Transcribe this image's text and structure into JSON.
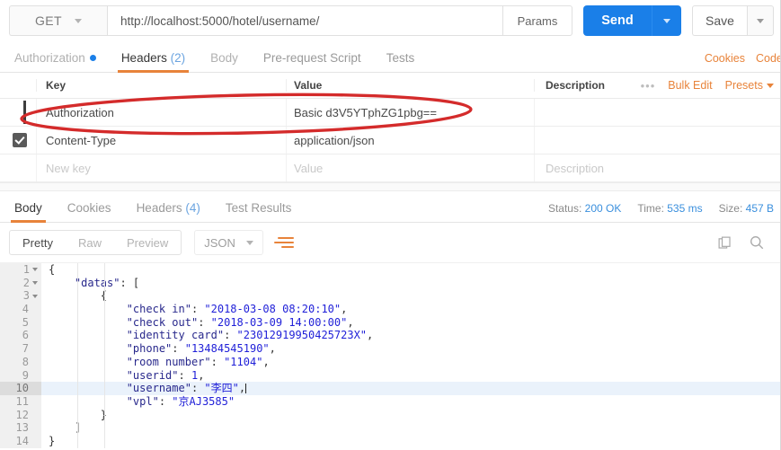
{
  "request": {
    "method": "GET",
    "url": "http://localhost:5000/hotel/username/",
    "params_label": "Params",
    "send_label": "Send",
    "save_label": "Save",
    "tabs": [
      {
        "label": "Authorization",
        "state": "has-dot"
      },
      {
        "label": "Headers",
        "count": "(2)",
        "state": "active"
      },
      {
        "label": "Body",
        "state": "disabled"
      },
      {
        "label": "Pre-request Script",
        "state": "normal"
      },
      {
        "label": "Tests",
        "state": "normal"
      }
    ],
    "links": {
      "cookies": "Cookies",
      "code": "Code"
    }
  },
  "headers_table": {
    "columns": {
      "key": "Key",
      "value": "Value",
      "description": "Description"
    },
    "tools": {
      "dots": "•••",
      "bulk_edit": "Bulk Edit",
      "presets": "Presets"
    },
    "rows": [
      {
        "checked": false,
        "handle": true,
        "key": "Authorization",
        "value": "Basic d3V5YTphZG1pbg==",
        "description": ""
      },
      {
        "checked": true,
        "handle": false,
        "key": "Content-Type",
        "value": "application/json",
        "description": ""
      }
    ],
    "new_row": {
      "key_placeholder": "New key",
      "value_placeholder": "Value",
      "description_placeholder": "Description"
    }
  },
  "annotation": {
    "shape": "ellipse",
    "color": "#d42b2b",
    "target": "Authorization header row"
  },
  "response": {
    "tabs": [
      {
        "label": "Body",
        "state": "active"
      },
      {
        "label": "Cookies",
        "state": "normal"
      },
      {
        "label": "Headers",
        "count": "(4)",
        "state": "normal"
      },
      {
        "label": "Test Results",
        "state": "normal"
      }
    ],
    "status": {
      "status_label": "Status:",
      "status_value": "200 OK",
      "time_label": "Time:",
      "time_value": "535 ms",
      "size_label": "Size:",
      "size_value": "457 B"
    },
    "view_modes": [
      {
        "label": "Pretty",
        "state": "active"
      },
      {
        "label": "Raw",
        "state": "normal"
      },
      {
        "label": "Preview",
        "state": "normal"
      }
    ],
    "format": "JSON",
    "icons": {
      "wrap": "word-wrap-icon",
      "copy": "copy-icon",
      "search": "search-icon"
    }
  },
  "body_code": {
    "language": "json",
    "highlighted_line": 10,
    "cursor_line": 10,
    "lines": [
      {
        "n": "1",
        "fold": true,
        "tokens": [
          {
            "t": "{",
            "c": "p"
          }
        ],
        "indent": 0
      },
      {
        "n": "2",
        "fold": true,
        "tokens": [
          {
            "t": "\"datas\"",
            "c": "k"
          },
          {
            "t": ": [",
            "c": "p"
          }
        ],
        "indent": 1
      },
      {
        "n": "3",
        "fold": true,
        "tokens": [
          {
            "t": "{",
            "c": "p"
          }
        ],
        "indent": 2
      },
      {
        "n": "4",
        "fold": false,
        "tokens": [
          {
            "t": "\"check in\"",
            "c": "k"
          },
          {
            "t": ": ",
            "c": "p"
          },
          {
            "t": "\"2018-03-08 08:20:10\"",
            "c": "s"
          },
          {
            "t": ",",
            "c": "p"
          }
        ],
        "indent": 3
      },
      {
        "n": "5",
        "fold": false,
        "tokens": [
          {
            "t": "\"check out\"",
            "c": "k"
          },
          {
            "t": ": ",
            "c": "p"
          },
          {
            "t": "\"2018-03-09 14:00:00\"",
            "c": "s"
          },
          {
            "t": ",",
            "c": "p"
          }
        ],
        "indent": 3
      },
      {
        "n": "6",
        "fold": false,
        "tokens": [
          {
            "t": "\"identity card\"",
            "c": "k"
          },
          {
            "t": ": ",
            "c": "p"
          },
          {
            "t": "\"23012919950425723X\"",
            "c": "s"
          },
          {
            "t": ",",
            "c": "p"
          }
        ],
        "indent": 3
      },
      {
        "n": "7",
        "fold": false,
        "tokens": [
          {
            "t": "\"phone\"",
            "c": "k"
          },
          {
            "t": ": ",
            "c": "p"
          },
          {
            "t": "\"13484545190\"",
            "c": "s"
          },
          {
            "t": ",",
            "c": "p"
          }
        ],
        "indent": 3
      },
      {
        "n": "8",
        "fold": false,
        "tokens": [
          {
            "t": "\"room number\"",
            "c": "k"
          },
          {
            "t": ": ",
            "c": "p"
          },
          {
            "t": "\"1104\"",
            "c": "s"
          },
          {
            "t": ",",
            "c": "p"
          }
        ],
        "indent": 3
      },
      {
        "n": "9",
        "fold": false,
        "tokens": [
          {
            "t": "\"userid\"",
            "c": "k"
          },
          {
            "t": ": ",
            "c": "p"
          },
          {
            "t": "1",
            "c": "n"
          },
          {
            "t": ",",
            "c": "p"
          }
        ],
        "indent": 3
      },
      {
        "n": "10",
        "fold": false,
        "tokens": [
          {
            "t": "\"username\"",
            "c": "k"
          },
          {
            "t": ": ",
            "c": "p"
          },
          {
            "t": "\"李四\"",
            "c": "s"
          },
          {
            "t": ",",
            "c": "p"
          }
        ],
        "indent": 3,
        "cursor": true
      },
      {
        "n": "11",
        "fold": false,
        "tokens": [
          {
            "t": "\"vpl\"",
            "c": "k"
          },
          {
            "t": ": ",
            "c": "p"
          },
          {
            "t": "\"京AJ3585\"",
            "c": "s"
          }
        ],
        "indent": 3
      },
      {
        "n": "12",
        "fold": false,
        "tokens": [
          {
            "t": "}",
            "c": "p"
          }
        ],
        "indent": 2
      },
      {
        "n": "13",
        "fold": false,
        "tokens": [
          {
            "t": "]",
            "c": "p"
          }
        ],
        "indent": 1
      },
      {
        "n": "14",
        "fold": false,
        "tokens": [
          {
            "t": "}",
            "c": "p"
          }
        ],
        "indent": 0
      }
    ]
  },
  "colors": {
    "accent_orange": "#e8833a",
    "send_blue": "#1a7fe8",
    "link_blue": "#3a8fdd",
    "annotation_red": "#d42b2b",
    "json_key": "#28288c",
    "json_string": "#1f1fd8"
  }
}
